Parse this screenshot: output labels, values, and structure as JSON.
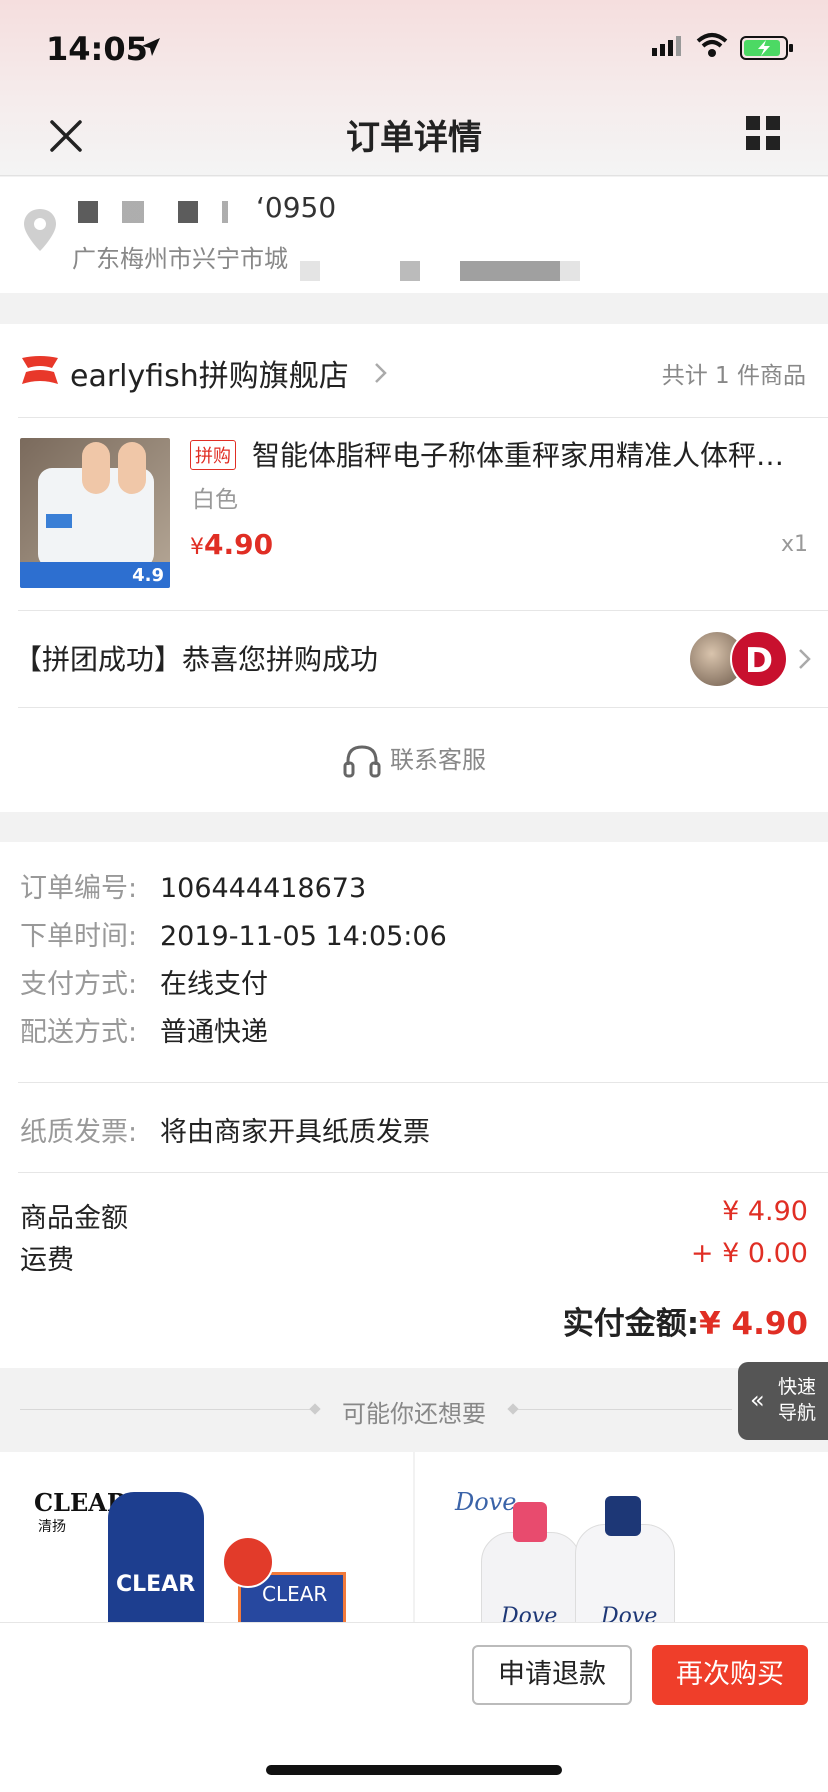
{
  "status_bar": {
    "time": "14:05"
  },
  "nav": {
    "title": "订单详情"
  },
  "address": {
    "name_phone": "‘0950",
    "line": "广东梅州市兴宁市城"
  },
  "store": {
    "name": "earlyfish拼购旗舰店",
    "item_count": "共计 1 件商品"
  },
  "product": {
    "tag": "拼购",
    "title": "智能体脂秤电子称体重秤家用精准人体秤…",
    "spec": "白色",
    "currency": "¥",
    "price": "4.90",
    "quantity": "x1",
    "image_price": "4.9"
  },
  "group": {
    "status": "【拼团成功】恭喜您拼购成功",
    "avatar2_text": "D"
  },
  "service": {
    "label": "联系客服"
  },
  "order_info": {
    "rows": [
      {
        "label": "订单编号:",
        "value": "106444418673"
      },
      {
        "label": "下单时间:",
        "value": "2019-11-05 14:05:06"
      },
      {
        "label": "支付方式:",
        "value": "在线支付"
      },
      {
        "label": "配送方式:",
        "value": "普通快递"
      }
    ],
    "invoice": {
      "label": "纸质发票:",
      "value": "将由商家开具纸质发票"
    }
  },
  "amounts": {
    "goods_label": "商品金额",
    "goods_value": "¥ 4.90",
    "shipping_label": "运费",
    "shipping_value": "+ ¥ 0.00",
    "total_label": "实付金额:",
    "total_value": "¥ 4.90"
  },
  "recommend": {
    "title": "可能你还想要",
    "items": [
      {
        "brand": "CLEAR",
        "brand_cn": "清扬",
        "bottle_label": "CLEAR",
        "refill_label": "CLEAR"
      },
      {
        "brand": "Dove",
        "bottle_label": "Dove"
      }
    ]
  },
  "quick_nav": {
    "arrows": "«",
    "label": "快速导航"
  },
  "bottom_bar": {
    "refund_label": "申请退款",
    "rebuy_label": "再次购买"
  },
  "colors": {
    "accent_red": "#e02e24",
    "button_red": "#ef3e2a",
    "muted_text": "#999999"
  },
  "icons": [
    "location-arrow-icon",
    "signal-icon",
    "wifi-icon",
    "battery-icon",
    "close-icon",
    "grid-icon",
    "pin-icon",
    "store-logo-icon",
    "chevron-right-icon",
    "headset-icon"
  ]
}
